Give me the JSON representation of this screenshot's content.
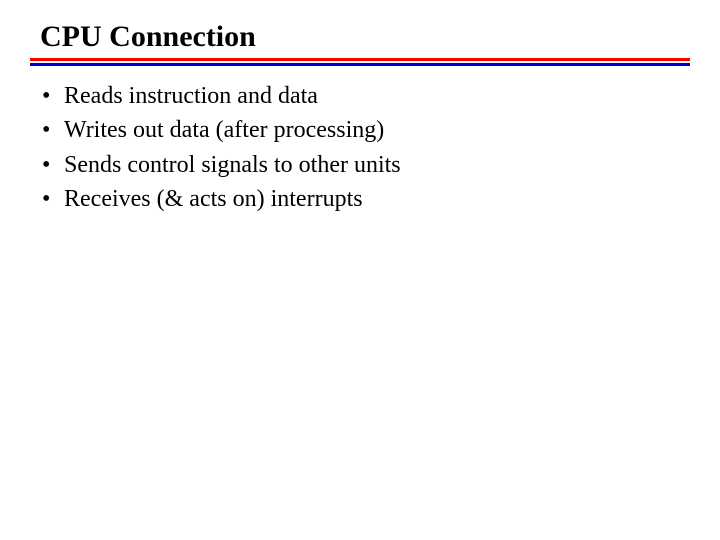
{
  "slide": {
    "title": "CPU Connection",
    "bullets": [
      "Reads instruction and data",
      "Writes out data (after processing)",
      "Sends control signals to other units",
      "Receives (& acts on) interrupts"
    ],
    "bullet_char": "•"
  }
}
